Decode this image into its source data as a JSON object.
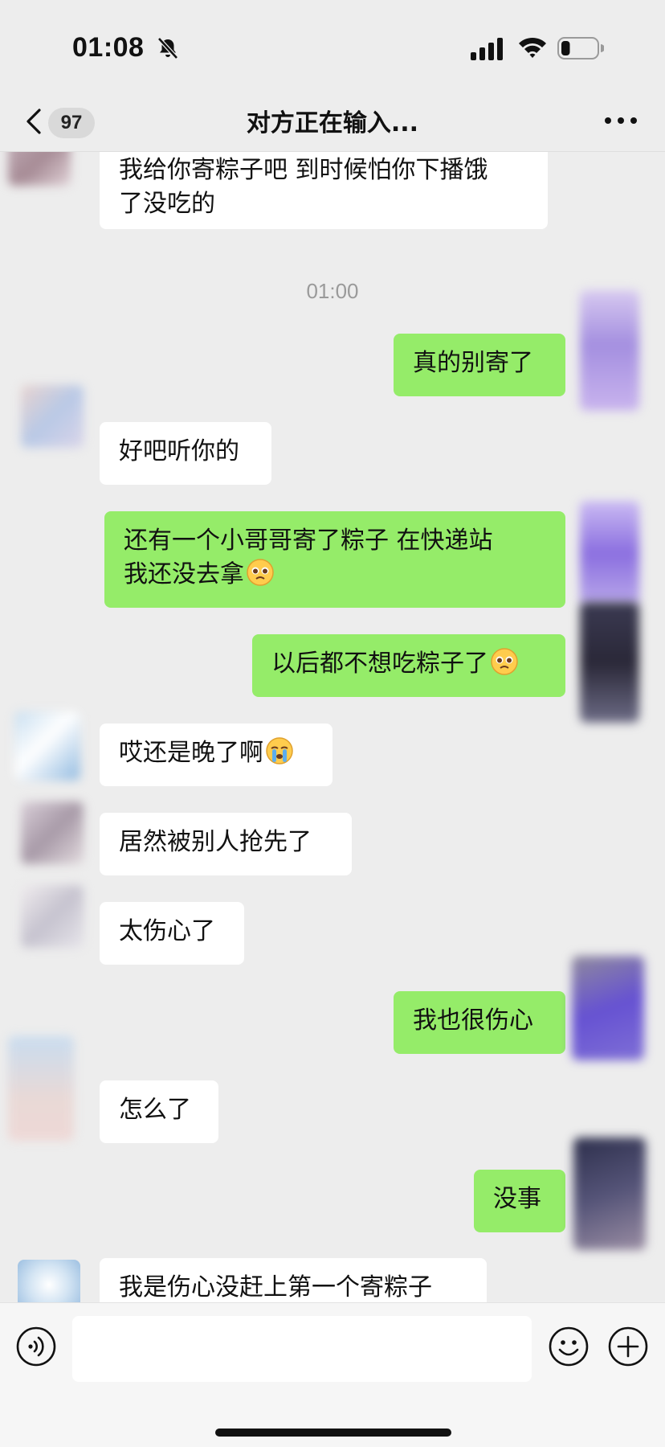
{
  "status_bar": {
    "time": "01:08",
    "muted_icon": "bell-slash-icon",
    "signal_icon": "signal-icon",
    "wifi_icon": "wifi-icon",
    "battery_icon": "battery-icon",
    "battery_level": 0.25
  },
  "header": {
    "back_icon": "chevron-left-icon",
    "unread_count": "97",
    "title": "对方正在输入...",
    "more_icon": "more-horizontal-icon"
  },
  "timestamp": "01:00",
  "messages": [
    {
      "direction": "in",
      "text": "我给你寄粽子吧 到时候怕你下播饿\n了没吃的"
    },
    {
      "direction": "out",
      "text": "真的别寄了"
    },
    {
      "direction": "in",
      "text": "好吧听你的"
    },
    {
      "direction": "out",
      "text": "还有一个小哥哥寄了粽子 在快递站\n我还没去拿",
      "emoji": "pleading-face"
    },
    {
      "direction": "out",
      "text": "以后都不想吃粽子了",
      "emoji": "pleading-face"
    },
    {
      "direction": "in",
      "text": "哎还是晚了啊",
      "emoji": "crying-face"
    },
    {
      "direction": "in",
      "text": "居然被别人抢先了"
    },
    {
      "direction": "in",
      "text": "太伤心了"
    },
    {
      "direction": "out",
      "text": "我也很伤心"
    },
    {
      "direction": "in",
      "text": "怎么了"
    },
    {
      "direction": "out",
      "text": "没事"
    },
    {
      "direction": "in",
      "text": "我是伤心没赶上第一个寄粽子"
    }
  ],
  "input_bar": {
    "voice_icon": "voice-icon",
    "input_value": "",
    "emoji_icon": "smiley-icon",
    "plus_icon": "plus-circle-icon"
  },
  "colors": {
    "background": "#ededed",
    "outgoing_bubble": "#95ec69",
    "incoming_bubble": "#ffffff",
    "timestamp": "#9a9a9a"
  }
}
